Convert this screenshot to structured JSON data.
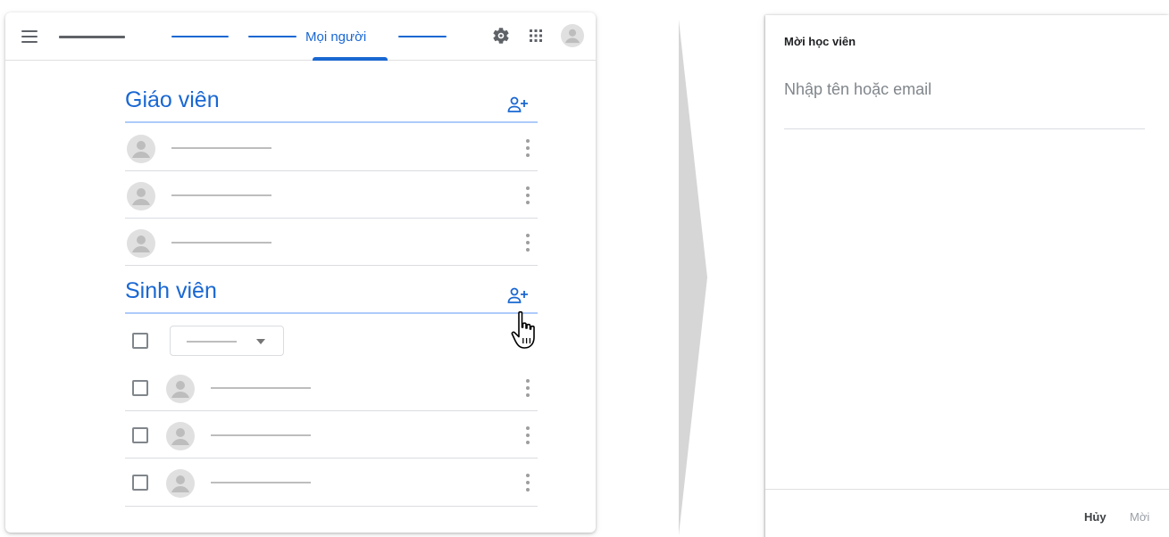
{
  "topbar": {
    "active_tab_label": "Mọi người",
    "menu_icon": "hamburger-menu-icon",
    "settings_icon": "gear-icon",
    "apps_icon": "apps-grid-icon",
    "account_icon": "account-avatar-icon"
  },
  "teachers": {
    "title": "Giáo viên",
    "add_icon": "add-person-icon",
    "rows": [
      {
        "icon": "avatar-icon"
      },
      {
        "icon": "avatar-icon"
      },
      {
        "icon": "avatar-icon"
      }
    ]
  },
  "students": {
    "title": "Sinh viên",
    "add_icon": "add-person-icon",
    "rows": [
      {
        "checked": false,
        "icon": "avatar-icon"
      },
      {
        "checked": false,
        "icon": "avatar-icon"
      },
      {
        "checked": false,
        "icon": "avatar-icon"
      }
    ]
  },
  "dialog": {
    "title": "Mời học viên",
    "input_placeholder": "Nhập tên hoặc email",
    "input_value": "",
    "cancel_label": "Hủy",
    "invite_label": "Mời"
  },
  "colors": {
    "accent": "#1967d2",
    "accent_light": "#aecbfa",
    "icon_gray": "#5f6368",
    "avatar_gray": "#bdbdbd",
    "divider": "#dadce0"
  }
}
